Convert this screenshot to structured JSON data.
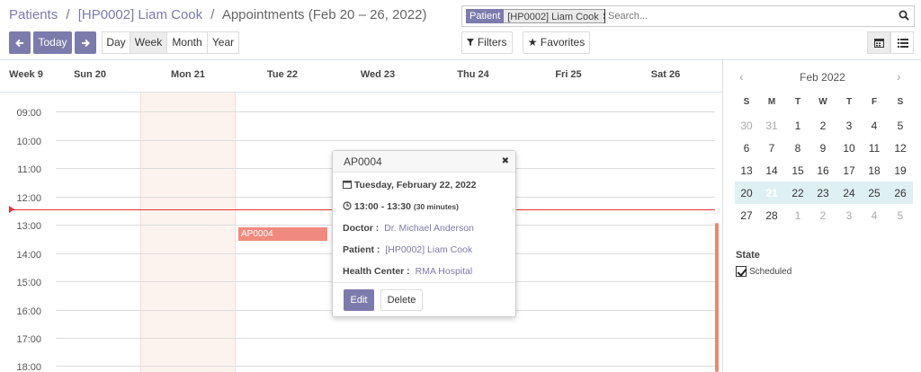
{
  "breadcrumb": {
    "items": [
      "Patients",
      "[HP0002] Liam Cook"
    ],
    "separator": "/",
    "current": "Appointments (Feb 20 – 26, 2022)"
  },
  "toolbar": {
    "prev_icon": "arrow-left-icon",
    "today_label": "Today",
    "next_icon": "arrow-right-icon",
    "scales": [
      "Day",
      "Week",
      "Month",
      "Year"
    ],
    "active_scale": "Week"
  },
  "search": {
    "facet_label": "Patient",
    "facet_value": "[HP0002] Liam Cook",
    "placeholder": "Search..."
  },
  "filters_label": "Filters",
  "favorites_label": "Favorites",
  "views": [
    "calendar",
    "list"
  ],
  "calendar": {
    "week_label": "Week 9",
    "days": [
      "Sun 20",
      "Mon 21",
      "Tue 22",
      "Wed 23",
      "Thu 24",
      "Fri 25",
      "Sat 26"
    ],
    "hours": [
      "09:00",
      "10:00",
      "11:00",
      "12:00",
      "13:00",
      "14:00",
      "15:00",
      "16:00",
      "17:00",
      "18:00"
    ],
    "event_title": "AP0004"
  },
  "popover": {
    "title": "AP0004",
    "date": "Tuesday, February 22, 2022",
    "time": "13:00 - 13:30",
    "duration": "(30 minutes)",
    "doctor_label": "Doctor :",
    "doctor": "Dr. Michael Anderson",
    "patient_label": "Patient :",
    "patient": "[HP0002] Liam Cook",
    "center_label": "Health Center :",
    "center": "RMA Hospital",
    "edit_label": "Edit",
    "delete_label": "Delete"
  },
  "mini_calendar": {
    "month": "Feb 2022",
    "dow": [
      "S",
      "M",
      "T",
      "W",
      "T",
      "F",
      "S"
    ],
    "weeks": [
      [
        "30",
        "31",
        "1",
        "2",
        "3",
        "4",
        "5"
      ],
      [
        "6",
        "7",
        "8",
        "9",
        "10",
        "11",
        "12"
      ],
      [
        "13",
        "14",
        "15",
        "16",
        "17",
        "18",
        "19"
      ],
      [
        "20",
        "21",
        "22",
        "23",
        "24",
        "25",
        "26"
      ],
      [
        "27",
        "28",
        "1",
        "2",
        "3",
        "4",
        "5"
      ]
    ]
  },
  "state": {
    "title": "State",
    "items": [
      "Scheduled"
    ]
  },
  "colors": {
    "primary": "#7c7bad",
    "event": "#f08a7e",
    "now_line": "#e0323a",
    "week_highlight": "#dff0f5"
  }
}
